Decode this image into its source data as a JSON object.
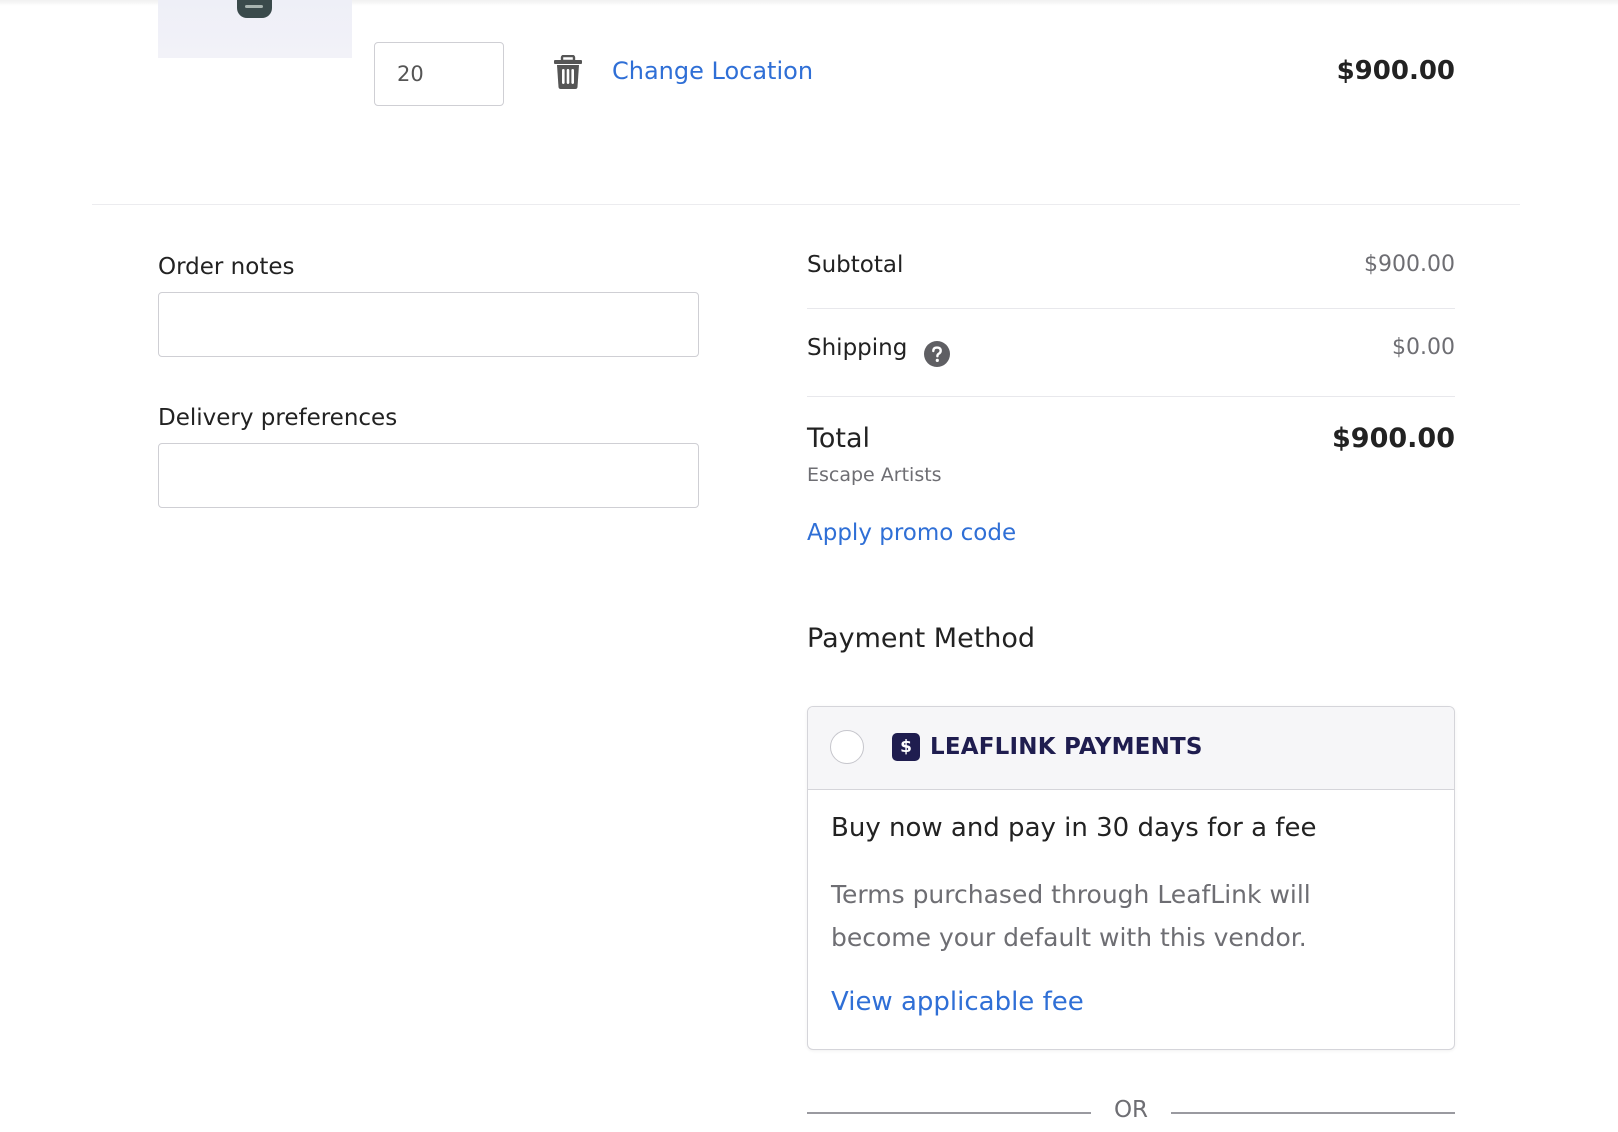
{
  "cart_item": {
    "quantity": "20",
    "change_location_label": "Change Location",
    "line_price": "$900.00"
  },
  "form": {
    "order_notes_label": "Order notes",
    "order_notes_value": "",
    "delivery_preferences_label": "Delivery preferences",
    "delivery_preferences_value": ""
  },
  "summary": {
    "subtotal_label": "Subtotal",
    "subtotal_value": "$900.00",
    "shipping_label": "Shipping",
    "shipping_value": "$0.00",
    "total_label": "Total",
    "total_value": "$900.00",
    "vendor": "Escape Artists",
    "promo_link": "Apply promo code"
  },
  "payment": {
    "title": "Payment Method",
    "option": {
      "brand_icon_glyph": "$",
      "brand_name": "LEAFLINK PAYMENTS",
      "headline": "Buy now and pay in 30 days for a fee",
      "description": "Terms purchased through LeafLink will become your default with this vendor.",
      "fee_link": "View applicable fee",
      "selected": false
    },
    "separator": "OR"
  },
  "icons": {
    "delete": "trash-icon",
    "shipping_help": "question-circle-icon",
    "brand": "dollar-badge-icon"
  },
  "colors": {
    "link": "#2f6fd6",
    "brand": "#1f1d4f",
    "muted_text": "#6e6e73"
  }
}
